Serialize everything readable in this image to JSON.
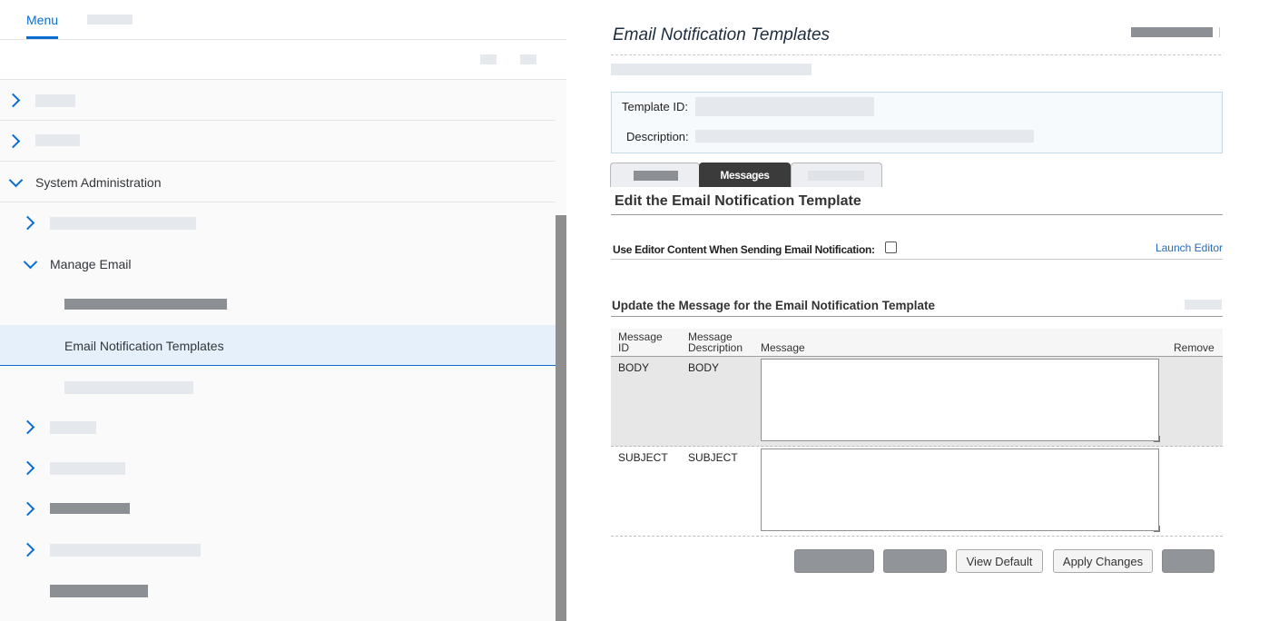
{
  "left_panel": {
    "tabs": {
      "menu_label": "Menu"
    },
    "items": [
      {
        "label": "System Administration"
      },
      {
        "label": "Manage Email"
      },
      {
        "label": "Email Notification Templates"
      }
    ]
  },
  "main": {
    "page_title": "Email Notification Templates",
    "template_id_label": "Template ID:",
    "description_label": "Description:",
    "tabs": {
      "messages_label": "Messages"
    },
    "section_title": "Edit the Email Notification Template",
    "editor_checkbox_label": "Use Editor Content When Sending Email Notification:",
    "editor_checkbox_checked": false,
    "launch_editor_label": "Launch Editor",
    "update_title": "Update the Message for the Email Notification Template",
    "table": {
      "headers": {
        "message_id_line1": "Message",
        "message_id_line2": "ID",
        "message_desc_line1": "Message",
        "message_desc_line2": "Description",
        "message": "Message",
        "remove": "Remove"
      },
      "rows": [
        {
          "id": "BODY",
          "description": "BODY",
          "message": ""
        },
        {
          "id": "SUBJECT",
          "description": "SUBJECT",
          "message": ""
        }
      ]
    },
    "buttons": {
      "view_default": "View Default",
      "apply_changes": "Apply Changes"
    }
  },
  "colors": {
    "accent": "#0a6ed1",
    "selected_row": "#e5f0fa",
    "active_tab": "#3b3b3b",
    "link": "#2a6ab3"
  }
}
